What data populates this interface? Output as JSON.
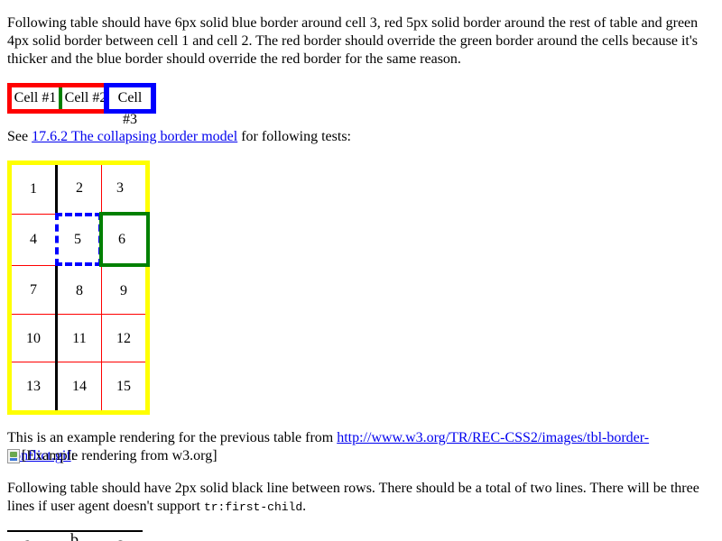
{
  "intro": "Following table should have 6px solid blue border around cell 3, red 5px solid border around the rest of table and green 4px solid border between cell 1 and cell 2. The red border should override the green border around the cells because it's thicker and the blue border should override the red border for the same reason.",
  "table1": {
    "cells": [
      "Cell #1",
      "Cell #2",
      "Cell #3"
    ]
  },
  "see": {
    "before": "See ",
    "link": "17.6.2 The collapsing border model",
    "after": " for following tests:"
  },
  "grid": {
    "cells": [
      "1",
      "2",
      "3",
      "4",
      "5",
      "6",
      "7",
      "8",
      "9",
      "10",
      "11",
      "12",
      "13",
      "14",
      "15"
    ]
  },
  "example": {
    "before": "This is an example rendering for the previous table from ",
    "link": "http://www.w3.org/TR/REC-CSS2/images/tbl-border-conflict.gif",
    "after": ":",
    "image_alt": "[Example rendering from w3.org]"
  },
  "following": {
    "text1": "Following table should have 2px solid black line between rows. There should be a total of two lines. There will be three lines if user agent doesn't support ",
    "code": "tr:first-child",
    "text2": "."
  },
  "table3": {
    "cells": [
      "a",
      "b",
      "c"
    ]
  },
  "colors": {
    "red": "#ff0000",
    "green": "#008000",
    "blue": "#0000ff",
    "yellow": "#ffff00",
    "link": "#0000ee"
  }
}
